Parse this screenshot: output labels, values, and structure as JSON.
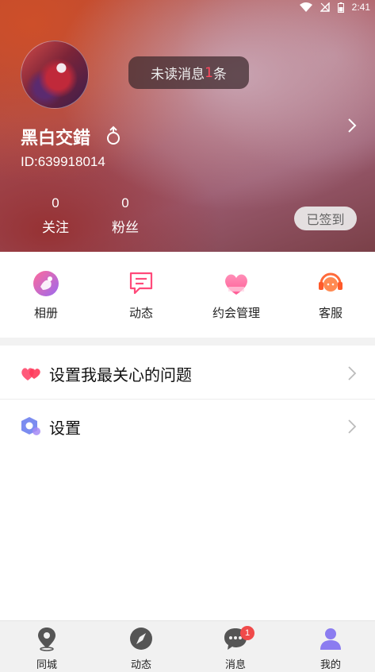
{
  "status_bar": {
    "time": "2:41"
  },
  "header": {
    "unread_prefix": "未读消息",
    "unread_count": "1",
    "unread_suffix": "条",
    "username": "黑白交錯",
    "user_id": "ID:639918014",
    "stats": [
      {
        "value": "0",
        "label": "关注"
      },
      {
        "value": "0",
        "label": "粉丝"
      }
    ],
    "signin_label": "已签到"
  },
  "shortcuts": [
    {
      "label": "相册",
      "icon": "album-icon"
    },
    {
      "label": "动态",
      "icon": "feed-icon"
    },
    {
      "label": "约会管理",
      "icon": "date-heart-icon"
    },
    {
      "label": "客服",
      "icon": "customer-service-icon"
    }
  ],
  "menu": [
    {
      "label": "设置我最关心的问题",
      "icon": "hearts-icon"
    },
    {
      "label": "设置",
      "icon": "settings-hex-icon"
    }
  ],
  "bottom_nav": [
    {
      "label": "同城",
      "icon": "location-pin-icon"
    },
    {
      "label": "动态",
      "icon": "compass-icon"
    },
    {
      "label": "消息",
      "icon": "chat-bubble-icon",
      "badge": "1"
    },
    {
      "label": "我的",
      "icon": "user-icon",
      "active": true
    }
  ],
  "colors": {
    "accent_pink": "#ff4a7a",
    "active_nav": "#8b7cf0",
    "badge_red": "#f04a4a"
  }
}
